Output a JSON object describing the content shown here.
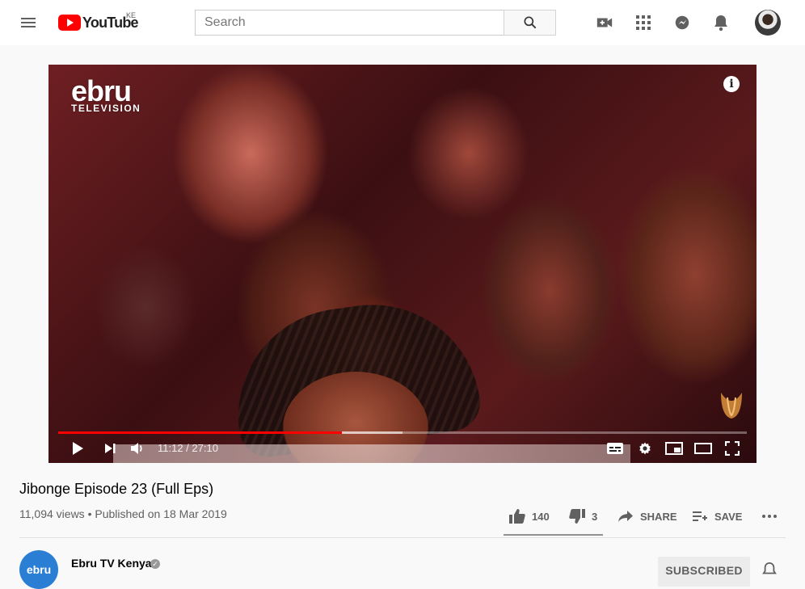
{
  "header": {
    "logo_text": "YouTube",
    "country_code": "KE",
    "search_placeholder": "Search",
    "icons": [
      "menu-icon",
      "create-video-icon",
      "apps-grid-icon",
      "messages-icon",
      "notifications-bell-icon",
      "account-avatar"
    ]
  },
  "player": {
    "channel_watermark_big": "ebru",
    "channel_watermark_small": "TELEVISION",
    "info_glyph": "i",
    "current_time": "11:12",
    "duration": "27:10",
    "time_display": "11:12 / 27:10",
    "progress_fraction": 0.4123,
    "buffered_fraction": 0.5,
    "controls": [
      "play-icon",
      "next-icon",
      "volume-icon",
      "subtitles-icon",
      "settings-icon",
      "miniplayer-icon",
      "theater-icon",
      "fullscreen-icon"
    ],
    "colors": {
      "progress": "#ff0000"
    }
  },
  "video": {
    "title": "Jibonge Episode 23 (Full Eps)",
    "views": "11,094 views",
    "published": "Published on 18 Mar 2019",
    "meta_line": "11,094 views • Published on 18 Mar 2019",
    "likes": "140",
    "dislikes": "3",
    "share_label": "SHARE",
    "save_label": "SAVE"
  },
  "channel": {
    "avatar_text": "ebru",
    "name": "Ebru TV Kenya",
    "subscribe_label": "SUBSCRIBED"
  }
}
